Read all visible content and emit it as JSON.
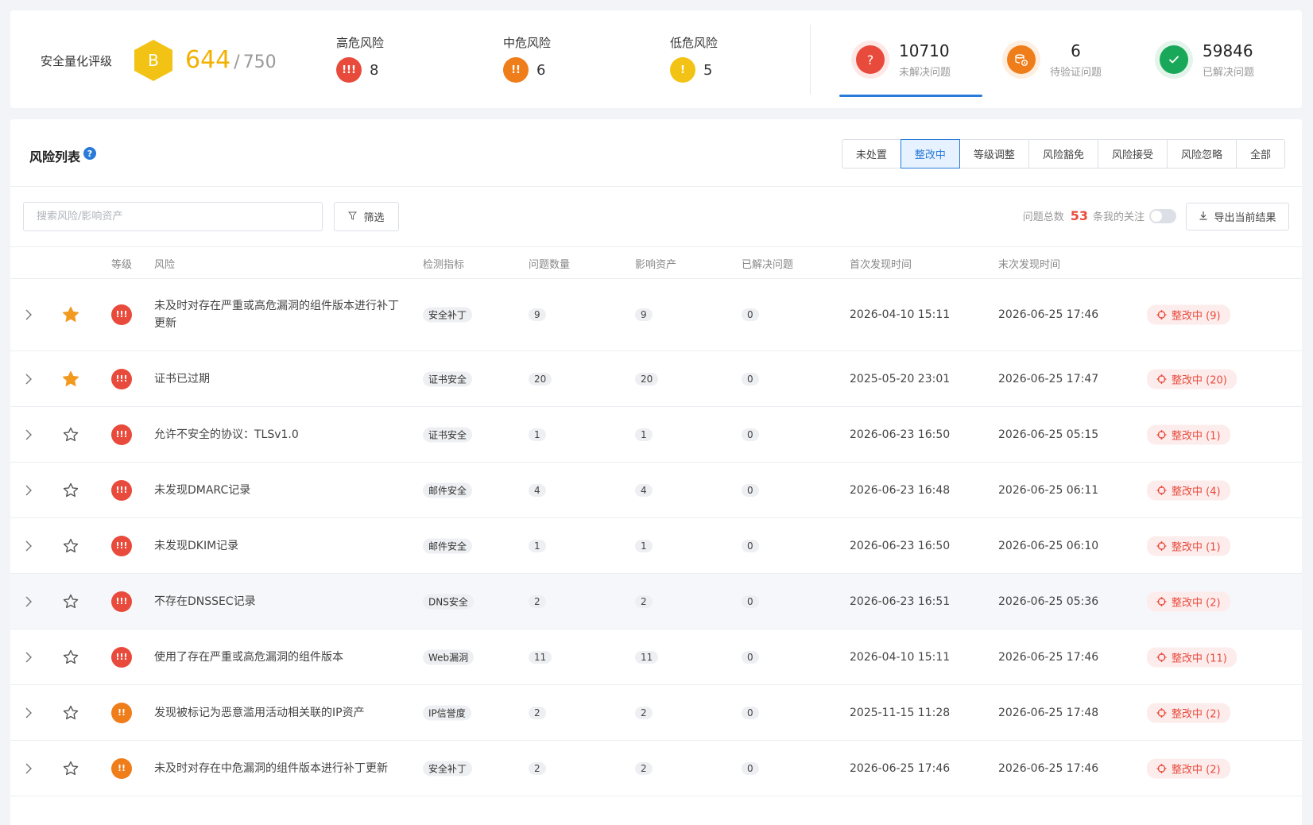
{
  "summary": {
    "rating_label": "安全量化评级",
    "grade": "B",
    "score": "644",
    "score_sep": "/",
    "score_max": "750",
    "levels": [
      {
        "label": "高危风险",
        "symbol": "!!!",
        "count": "8",
        "color": "#e84b3c"
      },
      {
        "label": "中危风险",
        "symbol": "!!",
        "count": "6",
        "color": "#ef7d1a"
      },
      {
        "label": "低危风险",
        "symbol": "!",
        "count": "5",
        "color": "#f2c315"
      }
    ],
    "stats": [
      {
        "value": "10710",
        "label": "未解决问题",
        "icon": "question-icon",
        "color": "#e84b3c",
        "bg": "#fde8e6"
      },
      {
        "value": "6",
        "label": "待验证问题",
        "icon": "verify-coins-icon",
        "color": "#ef7d1a",
        "bg": "#fdeedf"
      },
      {
        "value": "59846",
        "label": "已解决问题",
        "icon": "check-icon",
        "color": "#19a85a",
        "bg": "#e3f4ea"
      }
    ]
  },
  "list": {
    "title": "风险列表",
    "help_symbol": "?",
    "tabs": [
      {
        "label": "未处置",
        "active": false
      },
      {
        "label": "整改中",
        "active": true
      },
      {
        "label": "等级调整",
        "active": false
      },
      {
        "label": "风险豁免",
        "active": false
      },
      {
        "label": "风险接受",
        "active": false
      },
      {
        "label": "风险忽略",
        "active": false
      },
      {
        "label": "全部",
        "active": false
      }
    ],
    "search_placeholder": "搜索风险/影响资产",
    "filter_label": "筛选",
    "total_label": "问题总数",
    "total_count": "53",
    "total_unit": "条",
    "follow_label": "我的关注",
    "export_label": "导出当前结果",
    "columns": [
      "等级",
      "风险",
      "检测指标",
      "问题数量",
      "影响资产",
      "已解决问题",
      "首次发现时间",
      "末次发现时间"
    ],
    "rows": [
      {
        "starred": true,
        "level": "!!!",
        "level_color": "#e84b3c",
        "risk": "未及时对存在严重或高危漏洞的组件版本进行补丁更新",
        "indicator": "安全补丁",
        "count": "9",
        "assets": "9",
        "solved": "0",
        "first": "2026-04-10 15:11",
        "last": "2026-06-25 17:46",
        "status": "整改中 (9)"
      },
      {
        "starred": true,
        "level": "!!!",
        "level_color": "#e84b3c",
        "risk": "证书已过期",
        "indicator": "证书安全",
        "count": "20",
        "assets": "20",
        "solved": "0",
        "first": "2025-05-20 23:01",
        "last": "2026-06-25 17:47",
        "status": "整改中 (20)"
      },
      {
        "starred": false,
        "level": "!!!",
        "level_color": "#e84b3c",
        "risk": "允许不安全的协议：TLSv1.0",
        "indicator": "证书安全",
        "count": "1",
        "assets": "1",
        "solved": "0",
        "first": "2026-06-23 16:50",
        "last": "2026-06-25 05:15",
        "status": "整改中 (1)"
      },
      {
        "starred": false,
        "level": "!!!",
        "level_color": "#e84b3c",
        "risk": "未发现DMARC记录",
        "indicator": "邮件安全",
        "count": "4",
        "assets": "4",
        "solved": "0",
        "first": "2026-06-23 16:48",
        "last": "2026-06-25 06:11",
        "status": "整改中 (4)"
      },
      {
        "starred": false,
        "level": "!!!",
        "level_color": "#e84b3c",
        "risk": "未发现DKIM记录",
        "indicator": "邮件安全",
        "count": "1",
        "assets": "1",
        "solved": "0",
        "first": "2026-06-23 16:50",
        "last": "2026-06-25 06:10",
        "status": "整改中 (1)"
      },
      {
        "starred": false,
        "level": "!!!",
        "level_color": "#e84b3c",
        "risk": "不存在DNSSEC记录",
        "indicator": "DNS安全",
        "count": "2",
        "assets": "2",
        "solved": "0",
        "first": "2026-06-23 16:51",
        "last": "2026-06-25 05:36",
        "status": "整改中 (2)",
        "highlight": true
      },
      {
        "starred": false,
        "level": "!!!",
        "level_color": "#e84b3c",
        "risk": "使用了存在严重或高危漏洞的组件版本",
        "indicator": "Web漏洞",
        "count": "11",
        "assets": "11",
        "solved": "0",
        "first": "2026-04-10 15:11",
        "last": "2026-06-25 17:46",
        "status": "整改中 (11)"
      },
      {
        "starred": false,
        "level": "!!",
        "level_color": "#ef7d1a",
        "risk": "发现被标记为恶意滥用活动相关联的IP资产",
        "indicator": "IP信誉度",
        "count": "2",
        "assets": "2",
        "solved": "0",
        "first": "2025-11-15 11:28",
        "last": "2026-06-25 17:48",
        "status": "整改中 (2)"
      },
      {
        "starred": false,
        "level": "!!",
        "level_color": "#ef7d1a",
        "risk": "未及时对存在中危漏洞的组件版本进行补丁更新",
        "indicator": "安全补丁",
        "count": "2",
        "assets": "2",
        "solved": "0",
        "first": "2026-06-25 17:46",
        "last": "2026-06-25 17:46",
        "status": "整改中 (2)"
      }
    ]
  }
}
